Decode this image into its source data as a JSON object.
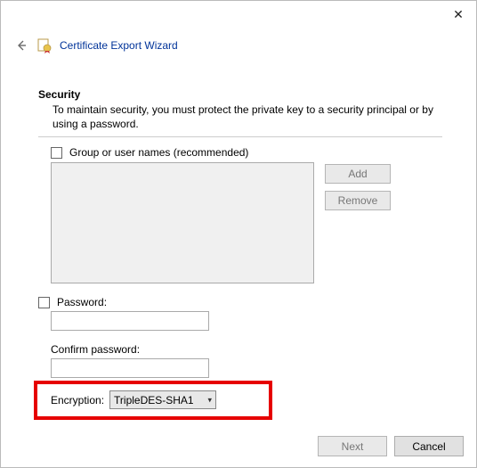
{
  "window": {
    "close_icon": "✕"
  },
  "header": {
    "back_icon": "←",
    "title": "Certificate Export Wizard"
  },
  "section": {
    "heading": "Security",
    "description": "To maintain security, you must protect the private key to a security principal or by using a password."
  },
  "group_checkbox": {
    "label": "Group or user names (recommended)"
  },
  "buttons": {
    "add": "Add",
    "remove": "Remove",
    "next": "Next",
    "cancel": "Cancel"
  },
  "password_checkbox": {
    "label": "Password:"
  },
  "confirm_label": "Confirm password:",
  "encryption": {
    "label": "Encryption:",
    "value": "TripleDES-SHA1"
  }
}
